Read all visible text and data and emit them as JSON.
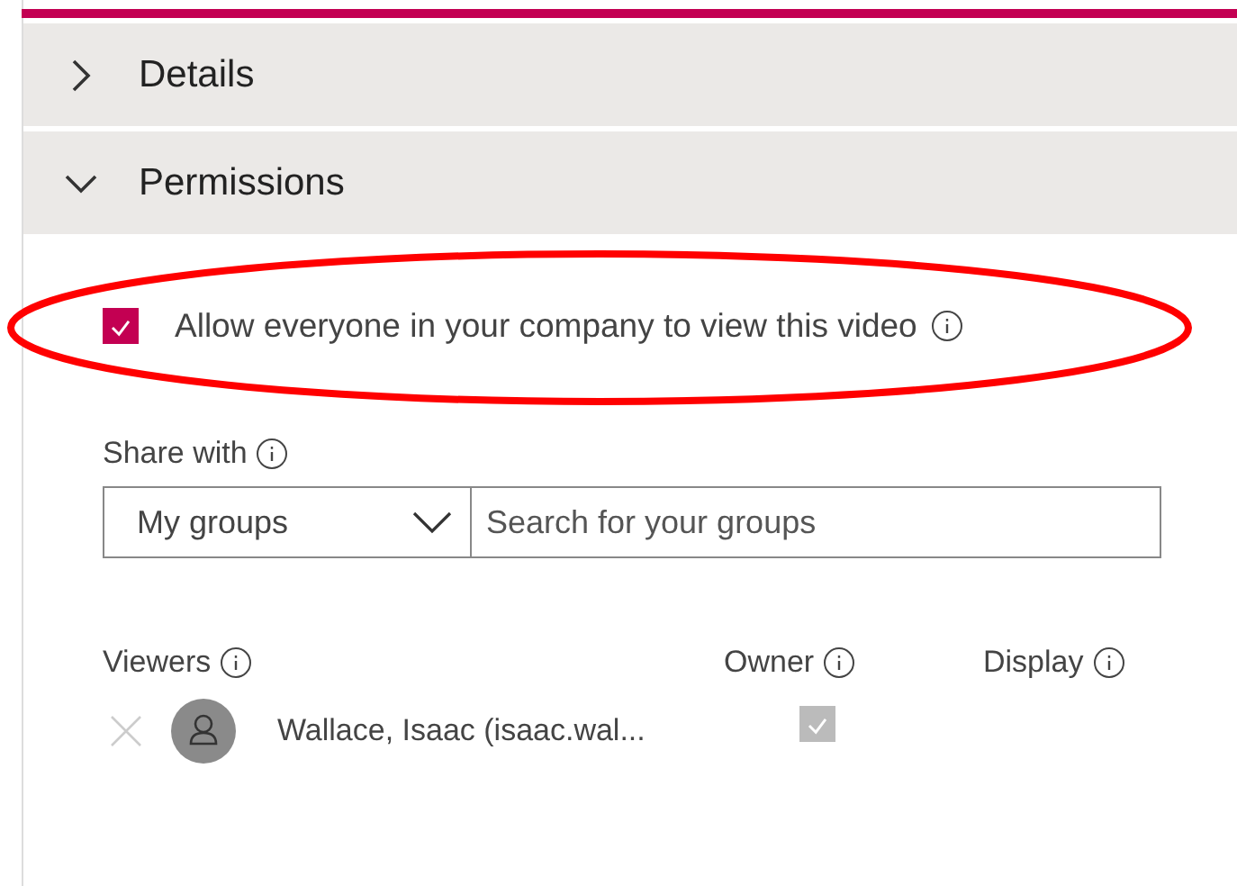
{
  "sections": [
    {
      "title": "Details",
      "expanded": false
    },
    {
      "title": "Permissions",
      "expanded": true
    }
  ],
  "permissions": {
    "allow_company": {
      "label": "Allow everyone in your company to view this video",
      "checked": true
    },
    "share_with": {
      "label": "Share with",
      "dropdown": {
        "value": "My groups"
      },
      "search": {
        "placeholder": "Search for your groups"
      }
    },
    "viewers": {
      "columns": [
        "Viewers",
        "Owner",
        "Display"
      ],
      "rows": [
        {
          "name": "Wallace, Isaac (isaac.wal...",
          "owner": true,
          "owner_disabled": true
        }
      ]
    }
  }
}
